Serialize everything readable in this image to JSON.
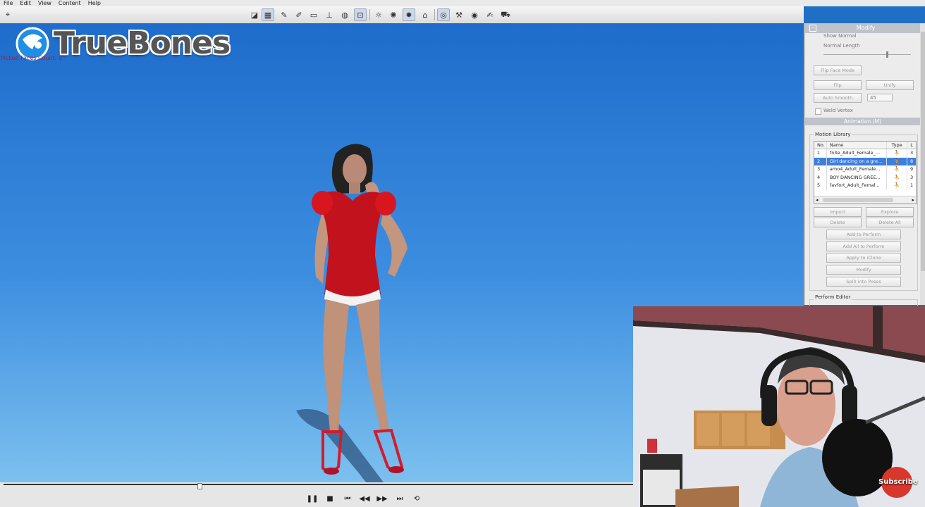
{
  "menu": {
    "items": [
      "File",
      "Edit",
      "View",
      "Content",
      "Help"
    ]
  },
  "logo": {
    "text": "TrueBones"
  },
  "stats": {
    "lines": [
      "Picked Faces Count: 0"
    ]
  },
  "toolbar": {
    "icons": [
      "select-icon",
      "move-icon",
      "grid-icon",
      "sculpt-icon",
      "paint-icon",
      "screen-icon",
      "pivot-icon",
      "sphere-icon",
      "frame-icon",
      "light-icon",
      "light2-icon",
      "gallery-icon",
      "globe-icon",
      "wrench-icon",
      "camera-icon",
      "cart-icon"
    ]
  },
  "panel": {
    "modify_title": "Modify",
    "show_normal": "Show Normal",
    "normal_length": "Normal Length",
    "normal_length_level": 0.72,
    "flip_face_mode": "Flip Face Mode",
    "flip": "Flip",
    "unify": "Unify",
    "auto_smooth": "Auto Smooth",
    "auto_smooth_value": "45",
    "weld_vertex": "Weld Vertex",
    "animation_title": "Animation (M)",
    "motion_library": "Motion Library",
    "columns": [
      "No.",
      "Name",
      "Type",
      "L"
    ],
    "rows": [
      {
        "no": "1",
        "name": "fnite_Adult_Female_...",
        "l": "3"
      },
      {
        "no": "2",
        "name": "Girl dancing on a gre...",
        "l": "8"
      },
      {
        "no": "3",
        "name": "amo4_Adult_Female...",
        "l": "9"
      },
      {
        "no": "4",
        "name": "BOY DANCING GREE...",
        "l": "3"
      },
      {
        "no": "5",
        "name": "favfort_Adult_Femal...",
        "l": "1"
      }
    ],
    "selected_row": 2,
    "import": "Import",
    "explore": "Explore",
    "delete": "Delete",
    "delete_all": "Delete All",
    "add_to_perform": "Add to Perform",
    "add_all_to_perform": "Add All to Perform",
    "apply_to_iclone": "Apply to iClone",
    "modify": "Modify",
    "split_into_poses": "Split into Poses",
    "perform_editor": "Perform Editor"
  },
  "timeline": {
    "position": 0.308
  },
  "playback": {
    "controls": [
      "pause",
      "stop",
      "first",
      "prev",
      "next",
      "loop"
    ]
  },
  "webcam": {
    "subscribe": "Subscribe"
  }
}
